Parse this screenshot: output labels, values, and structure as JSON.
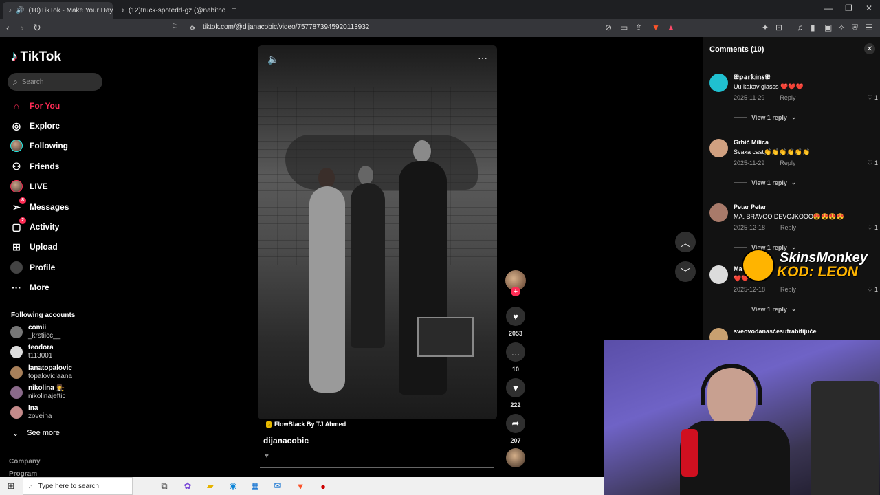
{
  "browser": {
    "tabs": [
      {
        "title": "(10)TikTok - Make Your Day",
        "active": true
      },
      {
        "title": "(12)truck-spotedd-gz (@nabitno16) |",
        "active": false
      }
    ],
    "new_tab_icon": "+",
    "url": "tiktok.com/@dijanacobic/video/7577873945920113932"
  },
  "sidebar": {
    "logo": "TikTok",
    "search_placeholder": "Search",
    "nav": [
      {
        "label": "For You",
        "icon": "home-icon"
      },
      {
        "label": "Explore",
        "icon": "compass-icon"
      },
      {
        "label": "Following",
        "icon": "following-avatar"
      },
      {
        "label": "Friends",
        "icon": "friends-icon"
      },
      {
        "label": "LIVE",
        "icon": "live-avatar"
      },
      {
        "label": "Messages",
        "icon": "messages-icon",
        "badge": "8"
      },
      {
        "label": "Activity",
        "icon": "activity-icon",
        "badge": "2"
      },
      {
        "label": "Upload",
        "icon": "upload-icon"
      },
      {
        "label": "Profile",
        "icon": "profile-avatar"
      },
      {
        "label": "More",
        "icon": "more-icon"
      }
    ],
    "following_title": "Following accounts",
    "following": [
      {
        "name": "comii",
        "handle": "_krstiicc__"
      },
      {
        "name": "teodora",
        "handle": "t113001"
      },
      {
        "name": "lanatopalovic",
        "handle": "topaloviclaana"
      },
      {
        "name": "nikolina 👩‍⚖️",
        "handle": "nikolinajeftic"
      },
      {
        "name": "Ina",
        "handle": "zoveina"
      }
    ],
    "see_more": "See more",
    "footer": [
      "Company",
      "Program"
    ]
  },
  "video": {
    "music": "FlowBlack By TJ Ahmed",
    "author": "dijanacobic",
    "actions": {
      "likes": "2053",
      "comments": "10",
      "saves": "222",
      "shares": "207"
    }
  },
  "comments": {
    "title": "Comments",
    "count": "(10)",
    "items": [
      {
        "user": "ꕥ𝕡𝕒𝕣𝕜𝕚𝕟𝕤ꕥ",
        "text": "Uu kakav glasss ❤️❤️❤️",
        "date": "2025-11-29",
        "reply": "Reply",
        "likes": "1",
        "view_replies": "View 1 reply"
      },
      {
        "user": "Grbić Milica",
        "text": "Svaka cast👏👏👏👏👏👏",
        "date": "2025-11-29",
        "reply": "Reply",
        "likes": "1",
        "view_replies": "View 1 reply"
      },
      {
        "user": "Petar Petar",
        "text": "MA. BRAVOO DEVOJKOOO😍😍😍😍",
        "date": "2025-12-18",
        "reply": "Reply",
        "likes": "1",
        "view_replies": "View 1 reply"
      },
      {
        "user": "Mar...",
        "text": "❤️❤️",
        "date": "2025-12-18",
        "reply": "Reply",
        "likes": "1",
        "view_replies": "View 1 reply"
      },
      {
        "user": "sveovodanasćesutrabitijuče",
        "text": "",
        "date": "",
        "reply": "",
        "likes": "",
        "view_replies": ""
      }
    ]
  },
  "overlay": {
    "brand": "SkinsMonkey",
    "code": "KOD: LEON"
  },
  "taskbar": {
    "search_placeholder": "Type here to search"
  },
  "colors": {
    "accent": "#fe2c55",
    "background": "#000000",
    "panel": "#121212"
  }
}
